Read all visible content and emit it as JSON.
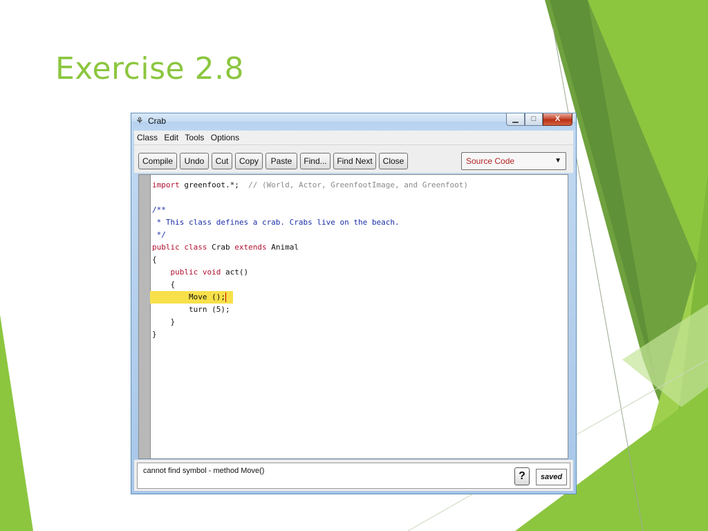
{
  "slide": {
    "title": "Exercise 2.8",
    "accent_color": "#8cc63f"
  },
  "window": {
    "title": "Crab",
    "app_icon": "greenfoot-icon",
    "controls": {
      "minimize": "minimize-icon",
      "maximize": "maximize-icon",
      "close": "close-icon"
    },
    "minimize_glyph": "▁",
    "maximize_glyph": "□",
    "close_glyph": "X"
  },
  "menubar": {
    "items": [
      "Class",
      "Edit",
      "Tools",
      "Options"
    ]
  },
  "toolbar": {
    "buttons": [
      "Compile",
      "Undo",
      "Cut",
      "Copy",
      "Paste",
      "Find...",
      "Find Next",
      "Close"
    ],
    "view_select": {
      "selected": "Source Code",
      "arrow": "▼"
    }
  },
  "editor": {
    "lines": [
      [
        {
          "t": "import",
          "c": "kw"
        },
        {
          "t": " greenfoot.*;  ",
          "c": "tx"
        },
        {
          "t": "// (World, Actor, GreenfootImage, and Greenfoot)",
          "c": "cm"
        }
      ],
      [],
      [
        {
          "t": "/**",
          "c": "jd"
        }
      ],
      [
        {
          "t": " * This class defines a crab. Crabs live on the beach.",
          "c": "jd"
        }
      ],
      [
        {
          "t": " */",
          "c": "jd"
        }
      ],
      [
        {
          "t": "public",
          "c": "kw"
        },
        {
          "t": " ",
          "c": "tx"
        },
        {
          "t": "class",
          "c": "kw"
        },
        {
          "t": " Crab ",
          "c": "tx"
        },
        {
          "t": "extends",
          "c": "kw"
        },
        {
          "t": " Animal",
          "c": "tx"
        }
      ],
      [
        {
          "t": "{",
          "c": "tx"
        }
      ],
      [
        {
          "t": "    ",
          "c": "tx"
        },
        {
          "t": "public",
          "c": "kw"
        },
        {
          "t": " ",
          "c": "tx"
        },
        {
          "t": "void",
          "c": "kw"
        },
        {
          "t": " act()",
          "c": "tx"
        }
      ],
      [
        {
          "t": "    {",
          "c": "tx"
        }
      ],
      [
        {
          "t": "        Move ();",
          "c": "tx"
        }
      ],
      [
        {
          "t": "        turn (5);",
          "c": "tx"
        }
      ],
      [
        {
          "t": "    }",
          "c": "tx"
        }
      ],
      [
        {
          "t": "}",
          "c": "tx"
        }
      ]
    ],
    "highlighted_line": 9
  },
  "status": {
    "message": "cannot find symbol - method Move()",
    "help_label": "?",
    "saved_label": "saved"
  }
}
